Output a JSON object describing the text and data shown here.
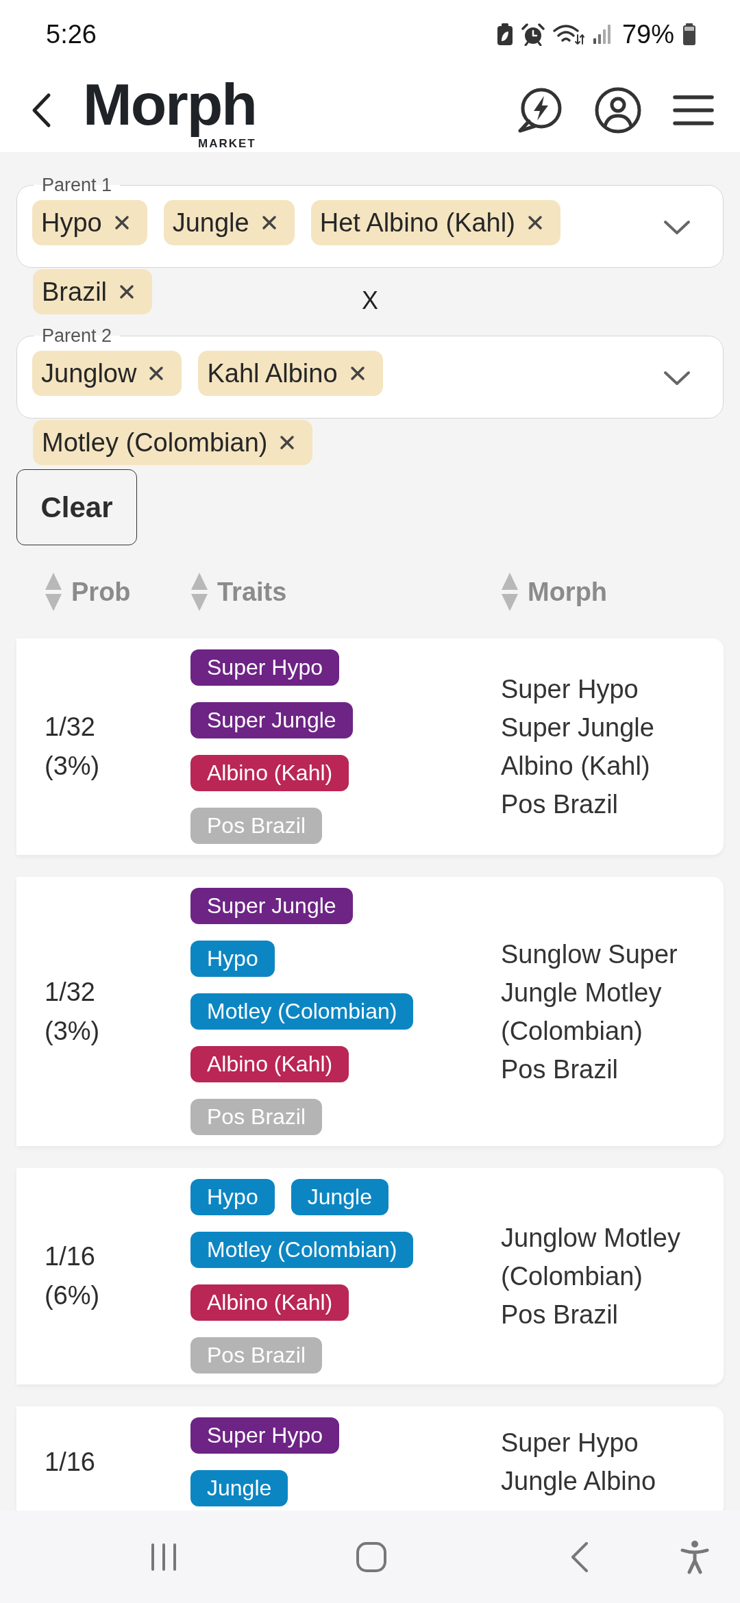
{
  "status_bar": {
    "time": "5:26",
    "battery_percent": "79%"
  },
  "header": {
    "logo": {
      "title": "Morph",
      "subtitle": "MARKET"
    }
  },
  "parents": [
    {
      "label": "Parent 1",
      "chips": [
        "Hypo",
        "Jungle",
        "Het Albino (Kahl)",
        "Brazil"
      ]
    },
    {
      "label": "Parent 2",
      "chips": [
        "Junglow",
        "Kahl Albino",
        "Motley (Colombian)"
      ]
    }
  ],
  "cross_label": "X",
  "clear_button": {
    "label": "Clear"
  },
  "table": {
    "columns": [
      {
        "label": "Prob"
      },
      {
        "label": "Traits"
      },
      {
        "label": "Morph"
      }
    ],
    "rows": [
      {
        "prob": "1/32 (3%)",
        "traits": [
          {
            "label": "Super Hypo",
            "color": "#6d2485"
          },
          {
            "label": "Super Jungle",
            "color": "#6d2485"
          },
          {
            "label": "Albino (Kahl)",
            "color": "#ba2656"
          },
          {
            "label": "Pos Brazil",
            "color": "#b4b4b4"
          }
        ],
        "morph": "Super Hypo Super Jungle Albino (Kahl) Pos Brazil"
      },
      {
        "prob": "1/32 (3%)",
        "traits": [
          {
            "label": "Super Jungle",
            "color": "#6d2485"
          },
          {
            "label": "Hypo",
            "color": "#0c86c3"
          },
          {
            "label": "Motley (Colombian)",
            "color": "#0c86c3"
          },
          {
            "label": "Albino (Kahl)",
            "color": "#ba2656"
          },
          {
            "label": "Pos Brazil",
            "color": "#b4b4b4"
          }
        ],
        "morph": "Sunglow Super Jungle Motley (Colombian) Pos Brazil"
      },
      {
        "prob": "1/16 (6%)",
        "traits": [
          {
            "label": "Hypo",
            "color": "#0c86c3"
          },
          {
            "label": "Jungle",
            "color": "#0c86c3"
          },
          {
            "label": "Motley (Colombian)",
            "color": "#0c86c3"
          },
          {
            "label": "Albino (Kahl)",
            "color": "#ba2656"
          },
          {
            "label": "Pos Brazil",
            "color": "#b4b4b4"
          }
        ],
        "morph": "Junglow Motley (Colombian) Pos Brazil"
      },
      {
        "prob": "1/16",
        "traits": [
          {
            "label": "Super Hypo",
            "color": "#6d2485"
          },
          {
            "label": "Jungle",
            "color": "#0c86c3"
          }
        ],
        "morph": "Super Hypo Jungle Albino"
      }
    ]
  }
}
